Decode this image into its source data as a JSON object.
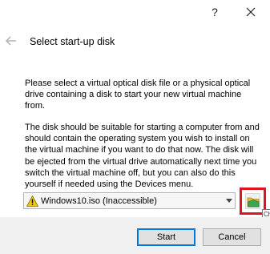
{
  "titlebar": {
    "help_label": "?",
    "close_icon": "close-icon"
  },
  "header": {
    "back_icon": "back-arrow-icon",
    "title": "Select start-up disk"
  },
  "content": {
    "paragraph1": "Please select a virtual optical disk file or a physical optical drive containing a disk to start your new virtual machine from.",
    "paragraph2": "The disk should be suitable for starting a computer from and should contain the operating system you wish to install on the virtual machine if you want to do that now. The disk will be ejected from the virtual drive automatically next time you switch the virtual machine off, but you can also do this yourself if needed using the Devices menu."
  },
  "disk_select": {
    "selected_value": "Windows10.iso (Inaccessible)",
    "status_icon": "warning-icon"
  },
  "browse": {
    "icon": "folder-browse-icon",
    "tooltip_fragment": "Ch"
  },
  "footer": {
    "start_label": "Start",
    "cancel_label": "Cancel"
  },
  "colors": {
    "highlight_border": "#e0141f",
    "default_button_border": "#0078d7",
    "warning_yellow": "#f2c511",
    "folder_yellow": "#e8b830",
    "folder_green": "#3aa655"
  }
}
